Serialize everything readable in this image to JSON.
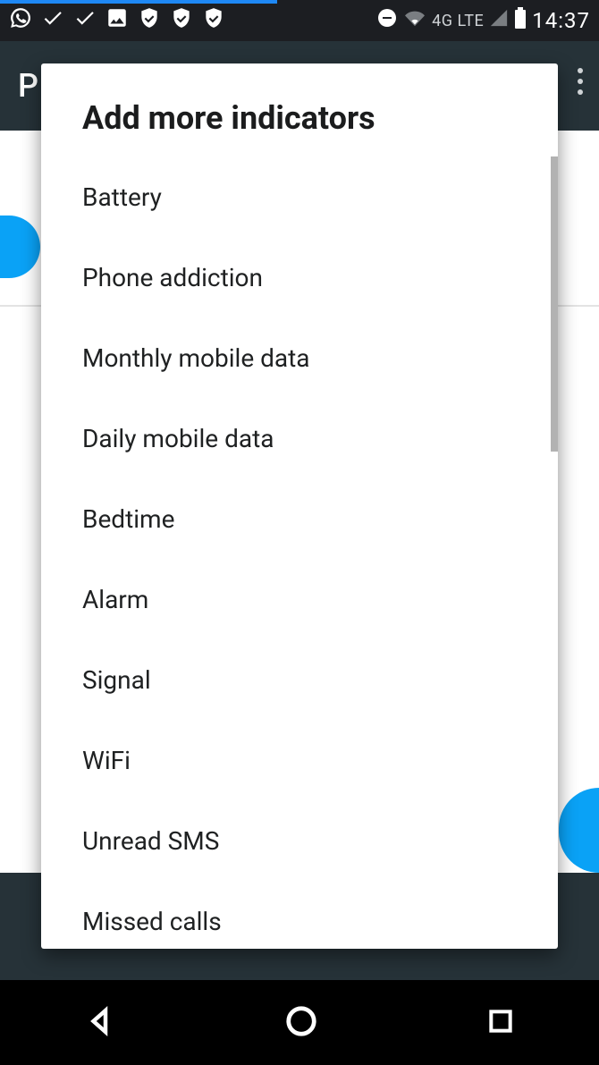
{
  "status": {
    "time": "14:37",
    "network": "4G LTE"
  },
  "app": {
    "title_initial": "P"
  },
  "dialog": {
    "title": "Add more indicators",
    "items": [
      "Battery",
      "Phone addiction",
      "Monthly mobile data",
      "Daily mobile data",
      "Bedtime",
      "Alarm",
      "Signal",
      "WiFi",
      "Unread SMS",
      "Missed calls"
    ]
  }
}
